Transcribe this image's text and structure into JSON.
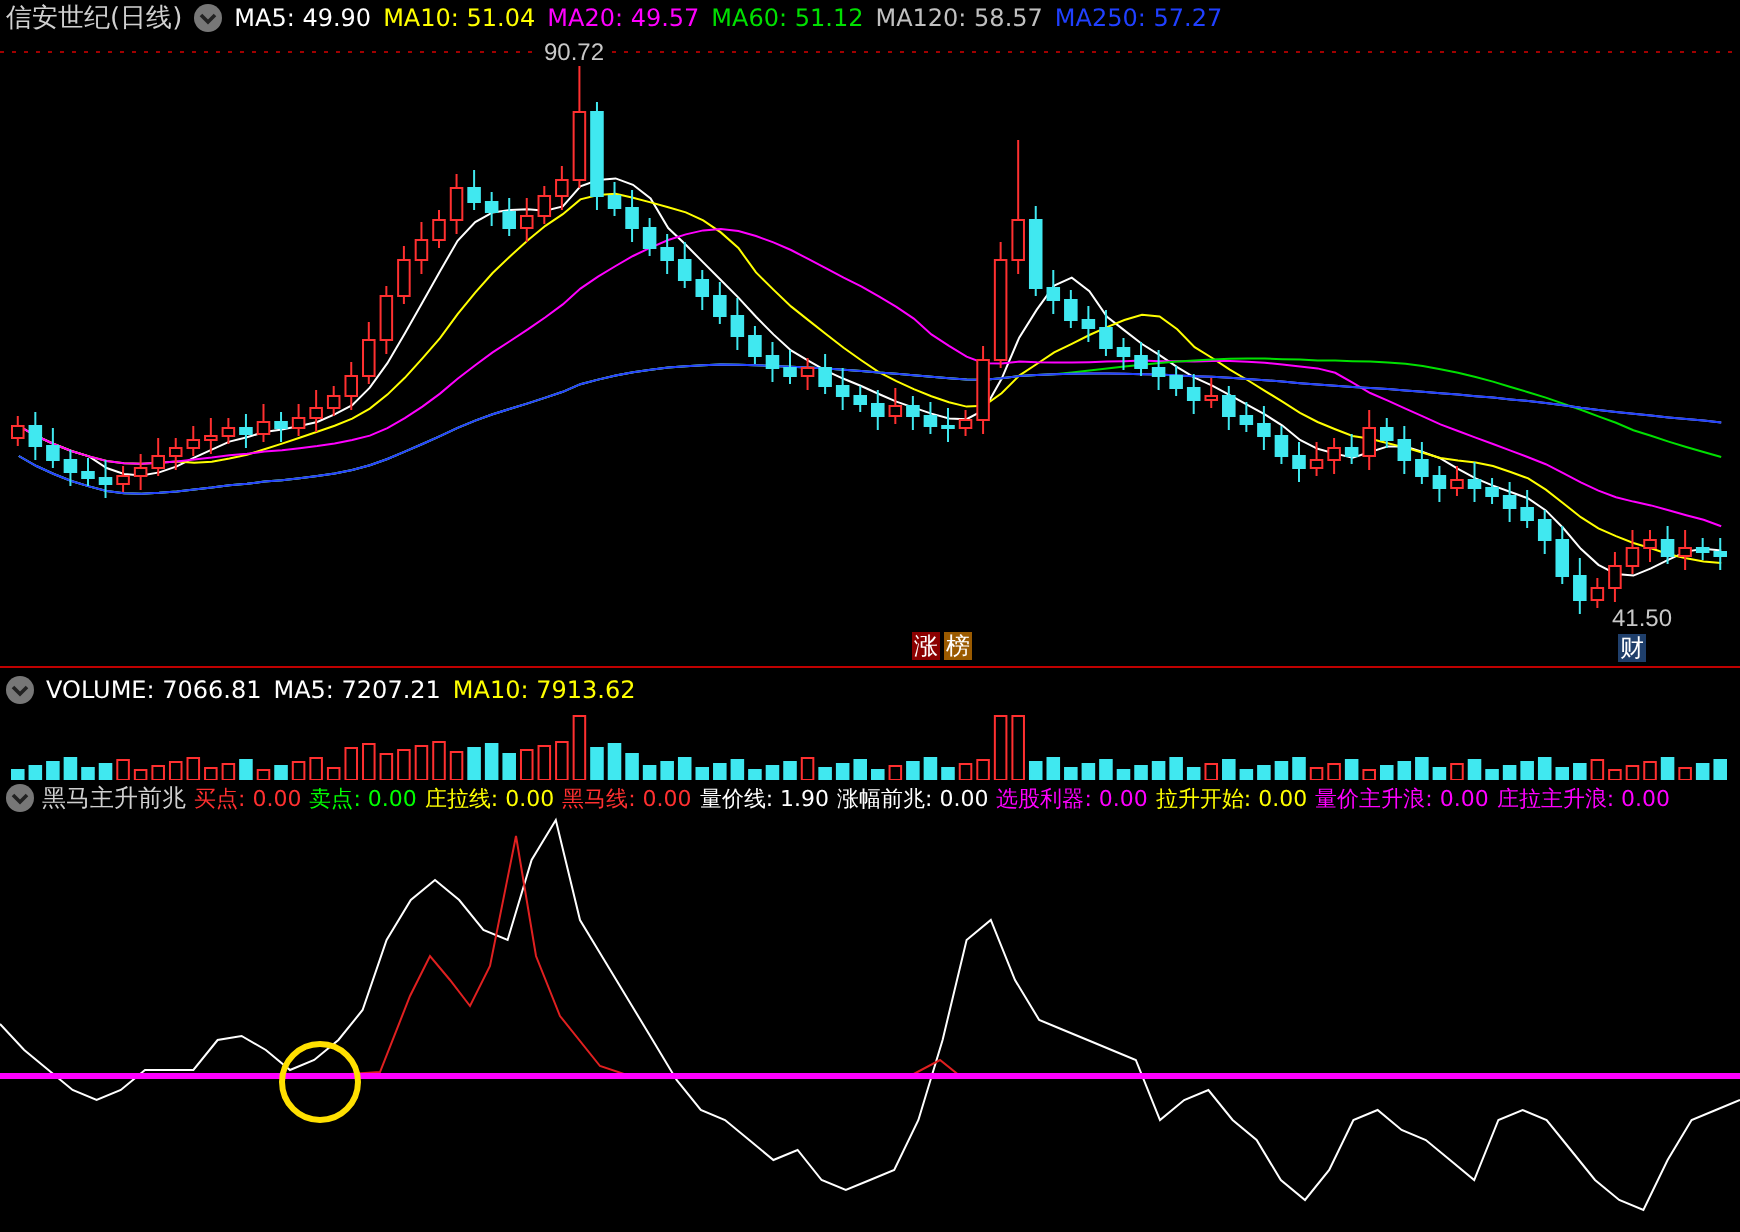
{
  "main": {
    "title": "信安世纪(日线)",
    "indicators": [
      {
        "label": "MA5: 49.90",
        "color": "#ffffff"
      },
      {
        "label": "MA10: 51.04",
        "color": "#ffff00"
      },
      {
        "label": "MA20: 49.57",
        "color": "#ff00ff"
      },
      {
        "label": "MA60: 51.12",
        "color": "#00e000"
      },
      {
        "label": "MA120: 58.57",
        "color": "#c0c0c0"
      },
      {
        "label": "MA250: 57.27",
        "color": "#2040ff"
      }
    ],
    "price_high": "90.72",
    "price_low": "41.50",
    "markers": [
      {
        "text": "涨",
        "color": "#8b0000"
      },
      {
        "text": "榜",
        "color": "#9a5a00"
      },
      {
        "text": "财",
        "color": "#1f3f6b"
      }
    ]
  },
  "volume": {
    "indicators": [
      {
        "label": "VOLUME: 7066.81",
        "color": "#ffffff"
      },
      {
        "label": "MA5: 7207.21",
        "color": "#ffffff"
      },
      {
        "label": "MA10: 7913.62",
        "color": "#ffff00"
      }
    ]
  },
  "signal": {
    "title": "黑马主升前兆",
    "indicators": [
      {
        "label": "买点: 0.00",
        "color": "#ff3030"
      },
      {
        "label": "卖点: 0.00",
        "color": "#00ff00"
      },
      {
        "label": "庄拉线: 0.00",
        "color": "#ffff00"
      },
      {
        "label": "黑马线: 0.00",
        "color": "#ff3030"
      },
      {
        "label": "量价线: 1.90",
        "color": "#ffffff"
      },
      {
        "label": "涨幅前兆: 0.00",
        "color": "#ffffff"
      },
      {
        "label": "选股利器: 0.00",
        "color": "#ff00ff"
      },
      {
        "label": "拉升开始: 0.00",
        "color": "#ffff00"
      },
      {
        "label": "量价主升浪: 0.00",
        "color": "#ff00ff"
      },
      {
        "label": "庄拉主升浪: 0.00",
        "color": "#ff00ff"
      }
    ]
  }
}
